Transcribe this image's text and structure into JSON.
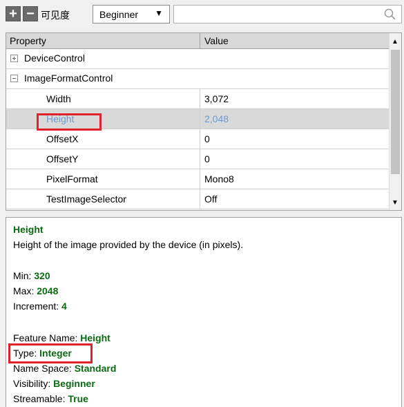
{
  "toolbar": {
    "add_label": "+",
    "remove_label": "−",
    "visibility_label": "可见度",
    "visibility_value": "Beginner",
    "dropdown_arrow": "▼",
    "search_placeholder": ""
  },
  "grid": {
    "col_property": "Property",
    "col_value": "Value",
    "categories": [
      {
        "label": "DeviceControl",
        "state": "collapsed"
      },
      {
        "label": "ImageFormatControl",
        "state": "expanded"
      }
    ],
    "rows": [
      {
        "name": "Width",
        "value": "3,072"
      },
      {
        "name": "Height",
        "value": "2,048",
        "selected": true
      },
      {
        "name": "OffsetX",
        "value": "0"
      },
      {
        "name": "OffsetY",
        "value": "0"
      },
      {
        "name": "PixelFormat",
        "value": "Mono8"
      },
      {
        "name": "TestImageSelector",
        "value": "Off"
      }
    ]
  },
  "description": {
    "title": "Height",
    "text": "Height of the image provided by the device (in pixels).",
    "min_label": "Min: ",
    "min_value": "320",
    "max_label": "Max: ",
    "max_value": "2048",
    "inc_label": "Increment: ",
    "inc_value": "4",
    "feature_label": "Feature Name: ",
    "feature_value": "Height",
    "type_label": "Type: ",
    "type_value": "Integer",
    "ns_label": "Name Space: ",
    "ns_value": "Standard",
    "vis_label": "Visibility: ",
    "vis_value": "Beginner",
    "stream_label": "Streamable: ",
    "stream_value": "True"
  },
  "colors": {
    "accent_green": "#0b6b12",
    "highlight_red": "#e0202a",
    "selected_text": "#6b9bd6"
  }
}
